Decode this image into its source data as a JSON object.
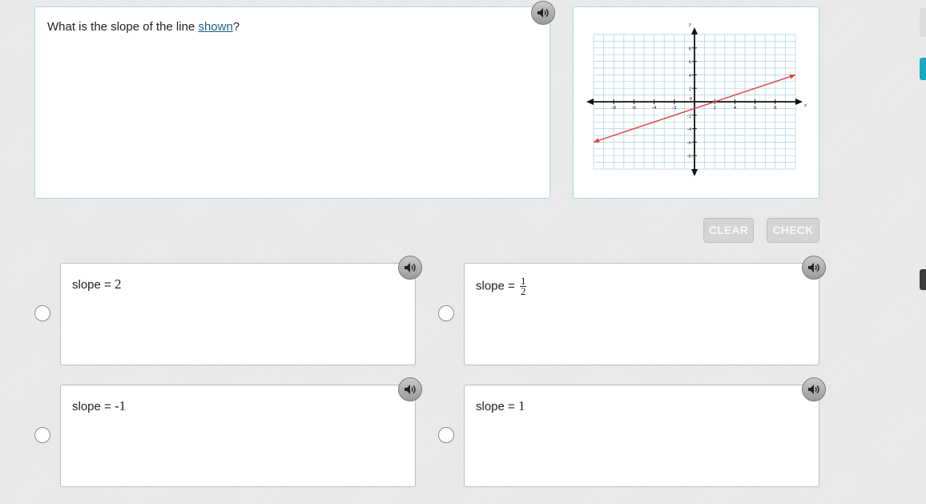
{
  "question": {
    "text_before": "What is the slope of the line ",
    "link_text": "shown",
    "text_after": "?"
  },
  "graph": {
    "x_tick_labels": [
      "-8",
      "-6",
      "-4",
      "-2",
      "2",
      "4",
      "6",
      "8"
    ],
    "y_tick_labels": [
      "8",
      "6",
      "4",
      "2",
      "-2",
      "-4",
      "-6",
      "-8"
    ],
    "origin_label": "0",
    "x_axis_label": "x",
    "y_axis_label": "y",
    "x_range": [
      -10,
      10
    ],
    "y_range": [
      -10,
      10
    ],
    "line": {
      "x1": -10,
      "y1": -6,
      "x2": 10,
      "y2": 4,
      "color": "#e04040"
    },
    "grid_color": "#a9cfe6"
  },
  "buttons": {
    "clear_label": "CLEAR",
    "check_label": "CHECK"
  },
  "choices": [
    {
      "label": "slope = ",
      "value": "2"
    },
    {
      "label": "slope = ",
      "numerator": "1",
      "denominator": "2"
    },
    {
      "label": "slope = ",
      "value": "-1"
    },
    {
      "label": "slope = ",
      "value": "1"
    }
  ],
  "icons": {
    "audio": "speaker-icon"
  },
  "colors": {
    "panel_border": "#a8d8e6",
    "link": "#1a5f8a",
    "accent_tab": "#1aa7c0"
  }
}
